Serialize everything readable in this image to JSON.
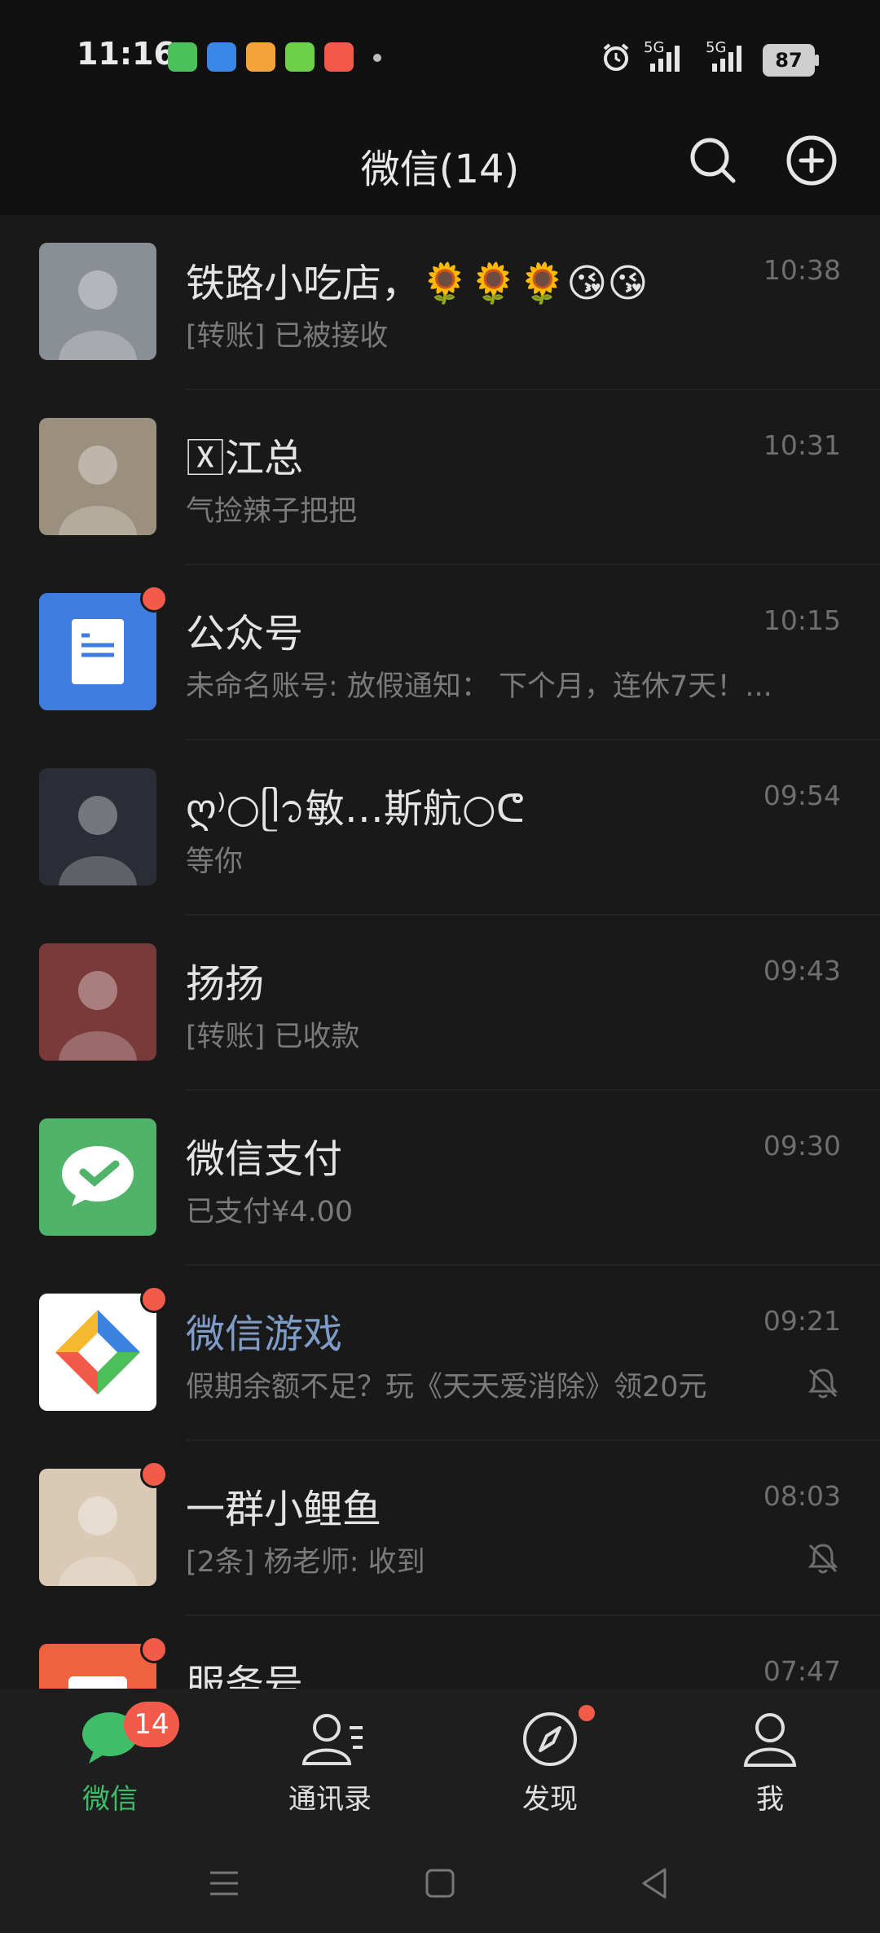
{
  "status_bar": {
    "time": "11:16",
    "signal1": "5G",
    "signal2": "5G",
    "battery": "87",
    "notification_colors": [
      "#4cc05b",
      "#3a86e6",
      "#f2a33a",
      "#6dd04a",
      "#f2594a"
    ]
  },
  "header": {
    "title": "微信(14)"
  },
  "chats": [
    {
      "name": "铁路小吃店，🌻🌻🌻😘😘",
      "message": "[转账] 已被接收",
      "time": "10:38",
      "unread_dot": false,
      "muted": false,
      "avatar_color": "#8a8f96"
    },
    {
      "name": "🅇江总",
      "message": "气捡辣子把把",
      "time": "10:31",
      "unread_dot": false,
      "muted": false,
      "avatar_color": "#9b8f7d"
    },
    {
      "name": "公众号",
      "message": "未命名账号: 放假通知： 下个月，连休7天！...",
      "time": "10:15",
      "unread_dot": true,
      "muted": false,
      "avatar_color": "#3f7ce0"
    },
    {
      "name": "ღ⁾○ᥫ᭡敏…斯航○ᕦ",
      "message": "等你",
      "time": "09:54",
      "unread_dot": false,
      "muted": false,
      "avatar_color": "#2a2d36"
    },
    {
      "name": "扬扬",
      "message": "[转账] 已收款",
      "time": "09:43",
      "unread_dot": false,
      "muted": false,
      "avatar_color": "#7a3a3a"
    },
    {
      "name": "微信支付",
      "message": "已支付¥4.00",
      "time": "09:30",
      "unread_dot": false,
      "muted": false,
      "avatar_color": "#4fb36a"
    },
    {
      "name": "微信游戏",
      "message": "假期余额不足？玩《天天爱消除》领20元",
      "time": "09:21",
      "unread_dot": true,
      "muted": true,
      "avatar_color": "#ffffff"
    },
    {
      "name": "一群小鲤鱼",
      "message": "[2条] 杨老师: 收到",
      "time": "08:03",
      "unread_dot": true,
      "muted": true,
      "avatar_color": "#d9c9b5"
    },
    {
      "name": "服务号",
      "message": "",
      "time": "07:47",
      "unread_dot": true,
      "muted": false,
      "avatar_color": "#f0623f"
    }
  ],
  "tabs": [
    {
      "label": "微信",
      "badge": "14"
    },
    {
      "label": "通讯录"
    },
    {
      "label": "发现"
    },
    {
      "label": "我"
    }
  ],
  "colors": {
    "accent": "#3fbe6a",
    "badge": "#f25a4a",
    "background": "#191919",
    "link_name": "#7f9bc7"
  }
}
